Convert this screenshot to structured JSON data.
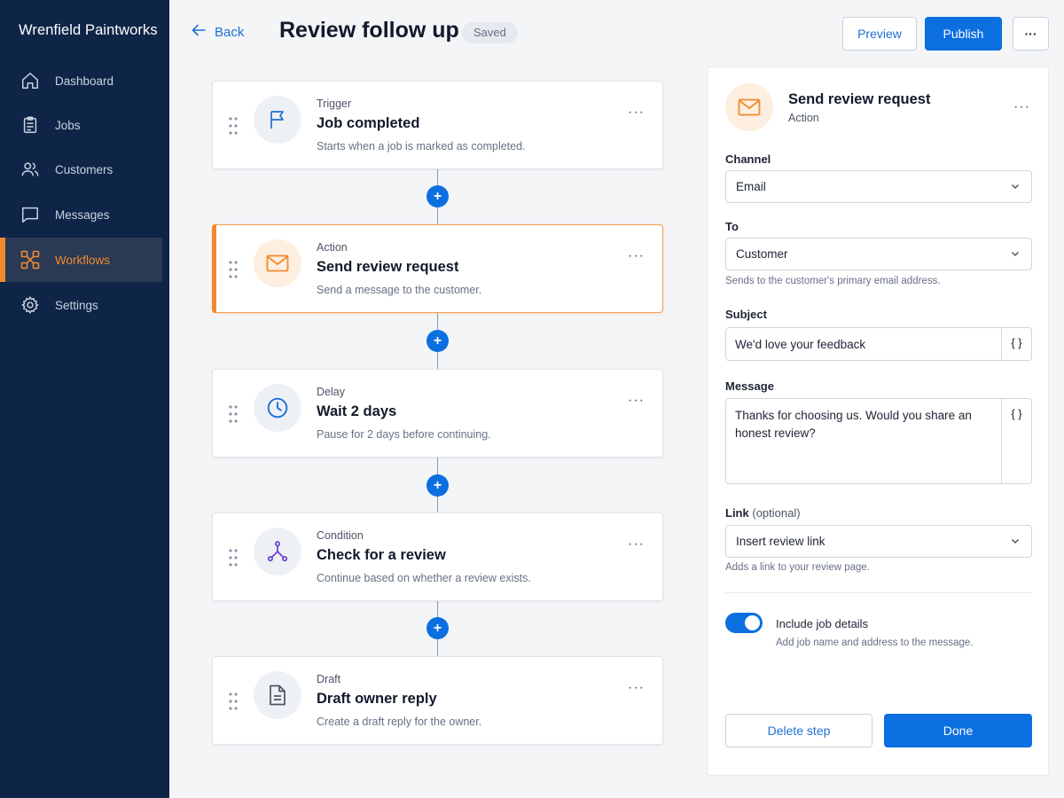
{
  "sidebar": {
    "brand": "Wrenfield Paintworks",
    "items": [
      {
        "label": "Dashboard",
        "icon": "home-icon"
      },
      {
        "label": "Jobs",
        "icon": "clipboard-icon"
      },
      {
        "label": "Customers",
        "icon": "users-icon"
      },
      {
        "label": "Messages",
        "icon": "chat-icon"
      },
      {
        "label": "Workflows",
        "icon": "workflow-icon",
        "active": true
      },
      {
        "label": "Settings",
        "icon": "gear-icon"
      }
    ]
  },
  "header": {
    "back_label": "Back",
    "title": "Review follow up",
    "status": "Saved",
    "preview_label": "Preview",
    "publish_label": "Publish",
    "more_label": "···"
  },
  "steps": [
    {
      "kicker": "Trigger",
      "title": "Job completed",
      "desc": "Starts when a job is marked as completed.",
      "icon": "flag-icon"
    },
    {
      "kicker": "Action",
      "title": "Send review request",
      "desc": "Send a message to the customer.",
      "icon": "mail-icon",
      "selected": true
    },
    {
      "kicker": "Delay",
      "title": "Wait 2 days",
      "desc": "Pause for 2 days before continuing.",
      "icon": "clock-icon"
    },
    {
      "kicker": "Condition",
      "title": "Check for a review",
      "desc": "Continue based on whether a review exists.",
      "icon": "branch-icon"
    },
    {
      "kicker": "Draft",
      "title": "Draft owner reply",
      "desc": "Create a draft reply for the owner.",
      "icon": "document-icon"
    }
  ],
  "step_menu": "···",
  "add_step": "+",
  "panel": {
    "title": "Send review request",
    "subtitle": "Action",
    "menu": "···",
    "channel_label": "Channel",
    "channel_value": "Email",
    "to_label": "To",
    "to_value": "Customer",
    "to_help": "Sends to the customer's primary email address.",
    "subject_label": "Subject",
    "subject_value": "We'd love your feedback",
    "message_label": "Message",
    "message_value": "Thanks for choosing us. Would you share an honest review?",
    "variable_glyph": "{ }",
    "link_label": "Link",
    "link_optional": "(optional)",
    "link_value": "Insert review link",
    "link_help": "Adds a link to your review page.",
    "toggle_label": "Include job details",
    "toggle_help": "Add job name and address to the message.",
    "toggle_on": true,
    "delete_label": "Delete step",
    "done_label": "Done"
  },
  "colors": {
    "sidebar_bg": "#0f2547",
    "accent_orange": "#f08a2e",
    "primary_blue": "#0b6fe0"
  }
}
